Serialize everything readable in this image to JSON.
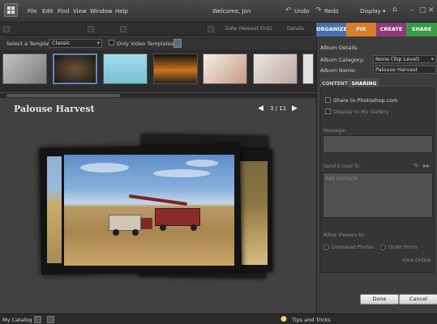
{
  "menubar": {
    "items": [
      "File",
      "Edit",
      "Find",
      "View",
      "Window",
      "Help"
    ],
    "welcome": "Welcome, Jon",
    "undo": "Undo",
    "redo": "Redo",
    "display": "Display ▾"
  },
  "toolbar": {
    "sort": "Date (Newest First)",
    "details": "Details"
  },
  "mode_tabs": [
    {
      "label": "ORGANIZE",
      "color": "#4b6fa8"
    },
    {
      "label": "FIX",
      "color": "#d57f2a"
    },
    {
      "label": "CREATE",
      "color": "#8b3a7a"
    },
    {
      "label": "SHARE",
      "color": "#3b9a45"
    }
  ],
  "template_bar": {
    "label": "Select a Template:",
    "selected": "Classic",
    "video_only": "Only Video Templates"
  },
  "preview": {
    "title": "Palouse Harvest",
    "counter": "3 / 11"
  },
  "right_panel": {
    "heading": "Album Details",
    "category_label": "Album Category:",
    "category_value": "None (Top Level)",
    "name_label": "Album Name:",
    "name_value": "Palouse Harvest",
    "tab_content": "CONTENT",
    "tab_sharing": "SHARING",
    "share_photoshop": "Share to Photoshop.com",
    "display_gallery": "Display In My Gallery",
    "message_label": "Message:",
    "send_email": "Send E-mail To:",
    "add_contacts": "Add Contacts",
    "allow_viewers": "Allow Viewers to:",
    "download_photos": "Download Photos",
    "order_prints": "Order Prints",
    "view_online": "View Online",
    "done": "Done",
    "cancel": "Cancel"
  },
  "statusbar": {
    "catalog": "My Catalog",
    "tips": "Tips and Tricks"
  },
  "thumbnails": [
    {
      "name": "thumb-1",
      "color": "#b8b8b8"
    },
    {
      "name": "thumb-2",
      "color": "#4a3c2a"
    },
    {
      "name": "thumb-3",
      "color": "#9ad3e0"
    },
    {
      "name": "thumb-4",
      "color": "#1a1a1a"
    },
    {
      "name": "thumb-5",
      "color": "#efe9df"
    },
    {
      "name": "thumb-6",
      "color": "#e6e2da"
    },
    {
      "name": "thumb-7",
      "color": "#dedede"
    }
  ]
}
